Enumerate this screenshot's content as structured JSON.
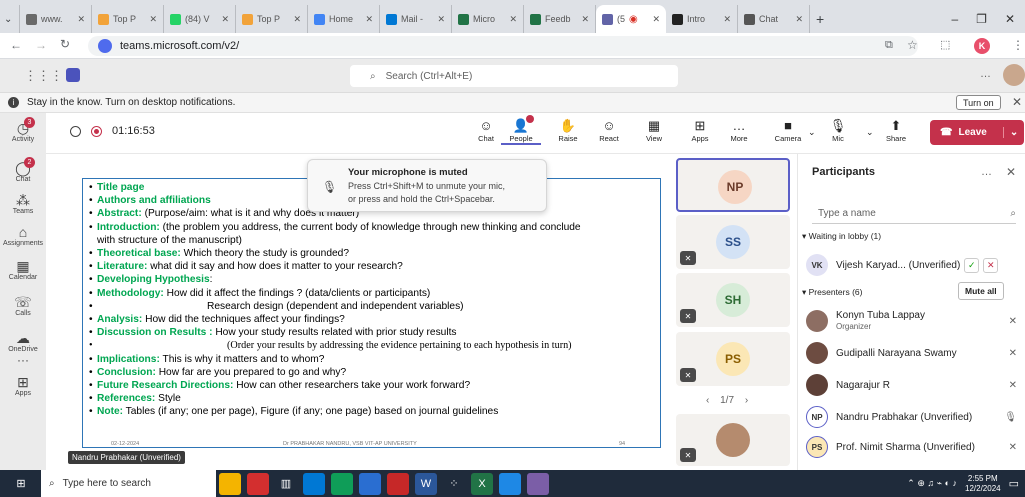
{
  "browser": {
    "tabs": [
      {
        "label": "www.",
        "color": "#6a6a6a"
      },
      {
        "label": "Top P",
        "color": "#f2a33a"
      },
      {
        "label": "(84) V",
        "color": "#25d366"
      },
      {
        "label": "Top P",
        "color": "#f2a33a"
      },
      {
        "label": "Home",
        "color": "#4285f4"
      },
      {
        "label": "Mail -",
        "color": "#0078d4"
      },
      {
        "label": "Micro",
        "color": "#217346"
      },
      {
        "label": "Feedb",
        "color": "#217346"
      },
      {
        "label": "(5",
        "color": "#6264a7"
      },
      {
        "label": "Intro",
        "color": "#222"
      },
      {
        "label": "Chat",
        "color": "#555"
      }
    ],
    "url": "teams.microsoft.com/v2/",
    "profile_initial": "K"
  },
  "teams": {
    "search_placeholder": "Search (Ctrl+Alt+E)",
    "notification": "Stay in the know. Turn on desktop notifications.",
    "turn_on": "Turn on"
  },
  "rail": [
    {
      "label": "Activity",
      "icon": "bell-icon",
      "badge": "3"
    },
    {
      "label": "Chat",
      "icon": "chat-icon",
      "badge": "2"
    },
    {
      "label": "Teams",
      "icon": "teams-icon",
      "badge": ""
    },
    {
      "label": "Assignments",
      "icon": "assignments-icon",
      "badge": ""
    },
    {
      "label": "Calendar",
      "icon": "calendar-icon",
      "badge": ""
    },
    {
      "label": "Calls",
      "icon": "phone-icon",
      "badge": ""
    },
    {
      "label": "OneDrive",
      "icon": "cloud-icon",
      "badge": ""
    },
    {
      "label": "Apps",
      "icon": "apps-icon",
      "badge": ""
    }
  ],
  "meeting": {
    "timer": "01:16:53",
    "tools": [
      {
        "label": "Chat",
        "glyph": "☺"
      },
      {
        "label": "People",
        "glyph": "👤"
      },
      {
        "label": "Raise",
        "glyph": "✋"
      },
      {
        "label": "React",
        "glyph": "☺"
      },
      {
        "label": "View",
        "glyph": "▦"
      },
      {
        "label": "Apps",
        "glyph": "⊞"
      },
      {
        "label": "More",
        "glyph": "…"
      },
      {
        "label": "Camera",
        "glyph": "■"
      },
      {
        "label": "Mic",
        "glyph": "🎙"
      },
      {
        "label": "Share",
        "glyph": "⬆"
      }
    ],
    "leave_label": "Leave",
    "mute_toast_title": "Your microphone is muted",
    "mute_toast_body_1": "Press Ctrl+Shift+M to unmute your mic,",
    "mute_toast_body_2": "or press and hold the Ctrl+Spacebar.",
    "presenter_tag": "Nandru Prabhakar (Unverified)"
  },
  "slide": {
    "lines": [
      {
        "head": "Title page",
        "rest": ""
      },
      {
        "head": "Authors and affiliations",
        "rest": ""
      },
      {
        "head": "Abstract:",
        "rest": " (Purpose/aim: what is it and why does it matter)"
      },
      {
        "head": "Introduction:",
        "rest": " (the problem you address, the current body of knowledge through new thinking and conclude"
      },
      {
        "head": "",
        "rest": "with structure of the manuscript)"
      },
      {
        "head": "Theoretical base:",
        "rest": " Which theory the study is grounded?"
      },
      {
        "head": "Literature:",
        "rest": " what did it say and how does it matter to your research?"
      },
      {
        "head": "Developing Hypothesis",
        "rest": ":"
      },
      {
        "head": "Methodology:",
        "rest": " How did it affect the findings ? (data/clients or participants)"
      },
      {
        "head": "",
        "rest": "Research design (dependent and independent variables)"
      },
      {
        "head": "Analysis:",
        "rest": " How did the techniques affect your findings?"
      },
      {
        "head": "Discussion on Results :",
        "rest": " How your study results related with prior study results"
      },
      {
        "head": "",
        "rest": "(Order your results by addressing the evidence pertaining to each hypothesis in turn)"
      },
      {
        "head": "Implications:",
        "rest": " This is why it matters and to whom?"
      },
      {
        "head": "Conclusion:",
        "rest": " How far are you prepared to go and why?"
      },
      {
        "head": "Future Research Directions:",
        "rest": " How can other researchers take your work forward?"
      },
      {
        "head": "References:",
        "rest": " Style"
      },
      {
        "head": "Note:",
        "rest": " Tables (if any; one per page), Figure (if any; one page) based on journal guidelines"
      }
    ],
    "footer_date": "02-12-2024",
    "footer_author": "Dr PRABHAKAR NANDRU, VSB VIT-AP UNIVERSITY",
    "footer_page": "94"
  },
  "tiles": [
    {
      "initials": "NP",
      "bg": "#f6d6c4",
      "fg": "#6b3b2a",
      "muted": false
    },
    {
      "initials": "SS",
      "bg": "#d3e2f5",
      "fg": "#2b4f8a",
      "muted": true
    },
    {
      "initials": "SH",
      "bg": "#d7ecd8",
      "fg": "#2e6b35",
      "muted": true
    },
    {
      "initials": "PS",
      "bg": "#fbe7b5",
      "fg": "#8a5d00",
      "muted": true
    }
  ],
  "pager": "1/7",
  "participants": {
    "title": "Participants",
    "search_placeholder": "Type a name",
    "lobby_header": "Waiting in lobby (1)",
    "lobby": [
      {
        "initials": "VK",
        "name": "Vijesh Karyad... (Unverified)"
      }
    ],
    "presenters_header": "Presenters (6)",
    "mute_all": "Mute all",
    "people": [
      {
        "initials": "",
        "name": "Konyn Tuba Lappay",
        "sub": "Organizer",
        "photo": true,
        "bg": "#8d6e63"
      },
      {
        "initials": "",
        "name": "Gudipalli Narayana Swamy",
        "sub": "",
        "photo": true,
        "bg": "#6d4c41"
      },
      {
        "initials": "",
        "name": "Nagarajur R",
        "sub": "",
        "photo": true,
        "bg": "#5d4037"
      },
      {
        "initials": "NP",
        "name": "Nandru Prabhakar (Unverified)",
        "sub": "",
        "photo": false,
        "bg": "#ffffff"
      },
      {
        "initials": "PS",
        "name": "Prof. Nimit Sharma (Unverified)",
        "sub": "",
        "photo": false,
        "bg": "#fbe7b5"
      }
    ]
  },
  "taskbar": {
    "search_placeholder": "Type here to search",
    "time": "2:55 PM",
    "date": "12/2/2024"
  }
}
